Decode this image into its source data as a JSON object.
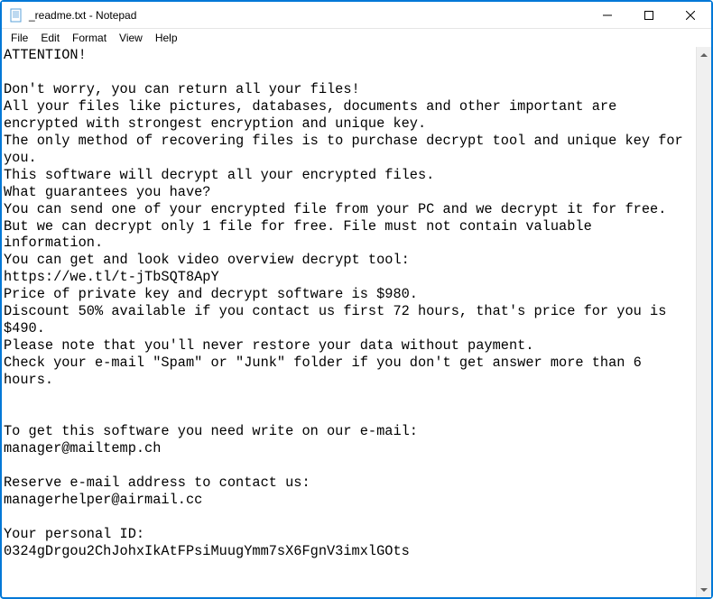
{
  "window": {
    "title": "_readme.txt - Notepad"
  },
  "menu": {
    "file": "File",
    "edit": "Edit",
    "format": "Format",
    "view": "View",
    "help": "Help"
  },
  "document": {
    "text": "ATTENTION!\n\nDon't worry, you can return all your files!\nAll your files like pictures, databases, documents and other important are encrypted with strongest encryption and unique key.\nThe only method of recovering files is to purchase decrypt tool and unique key for you.\nThis software will decrypt all your encrypted files.\nWhat guarantees you have?\nYou can send one of your encrypted file from your PC and we decrypt it for free.\nBut we can decrypt only 1 file for free. File must not contain valuable information.\nYou can get and look video overview decrypt tool:\nhttps://we.tl/t-jTbSQT8ApY\nPrice of private key and decrypt software is $980.\nDiscount 50% available if you contact us first 72 hours, that's price for you is $490.\nPlease note that you'll never restore your data without payment.\nCheck your e-mail \"Spam\" or \"Junk\" folder if you don't get answer more than 6 hours.\n\n\nTo get this software you need write on our e-mail:\nmanager@mailtemp.ch\n\nReserve e-mail address to contact us:\nmanagerhelper@airmail.cc\n\nYour personal ID:\n0324gDrgou2ChJohxIkAtFPsiMuugYmm7sX6FgnV3imxlGOts"
  }
}
